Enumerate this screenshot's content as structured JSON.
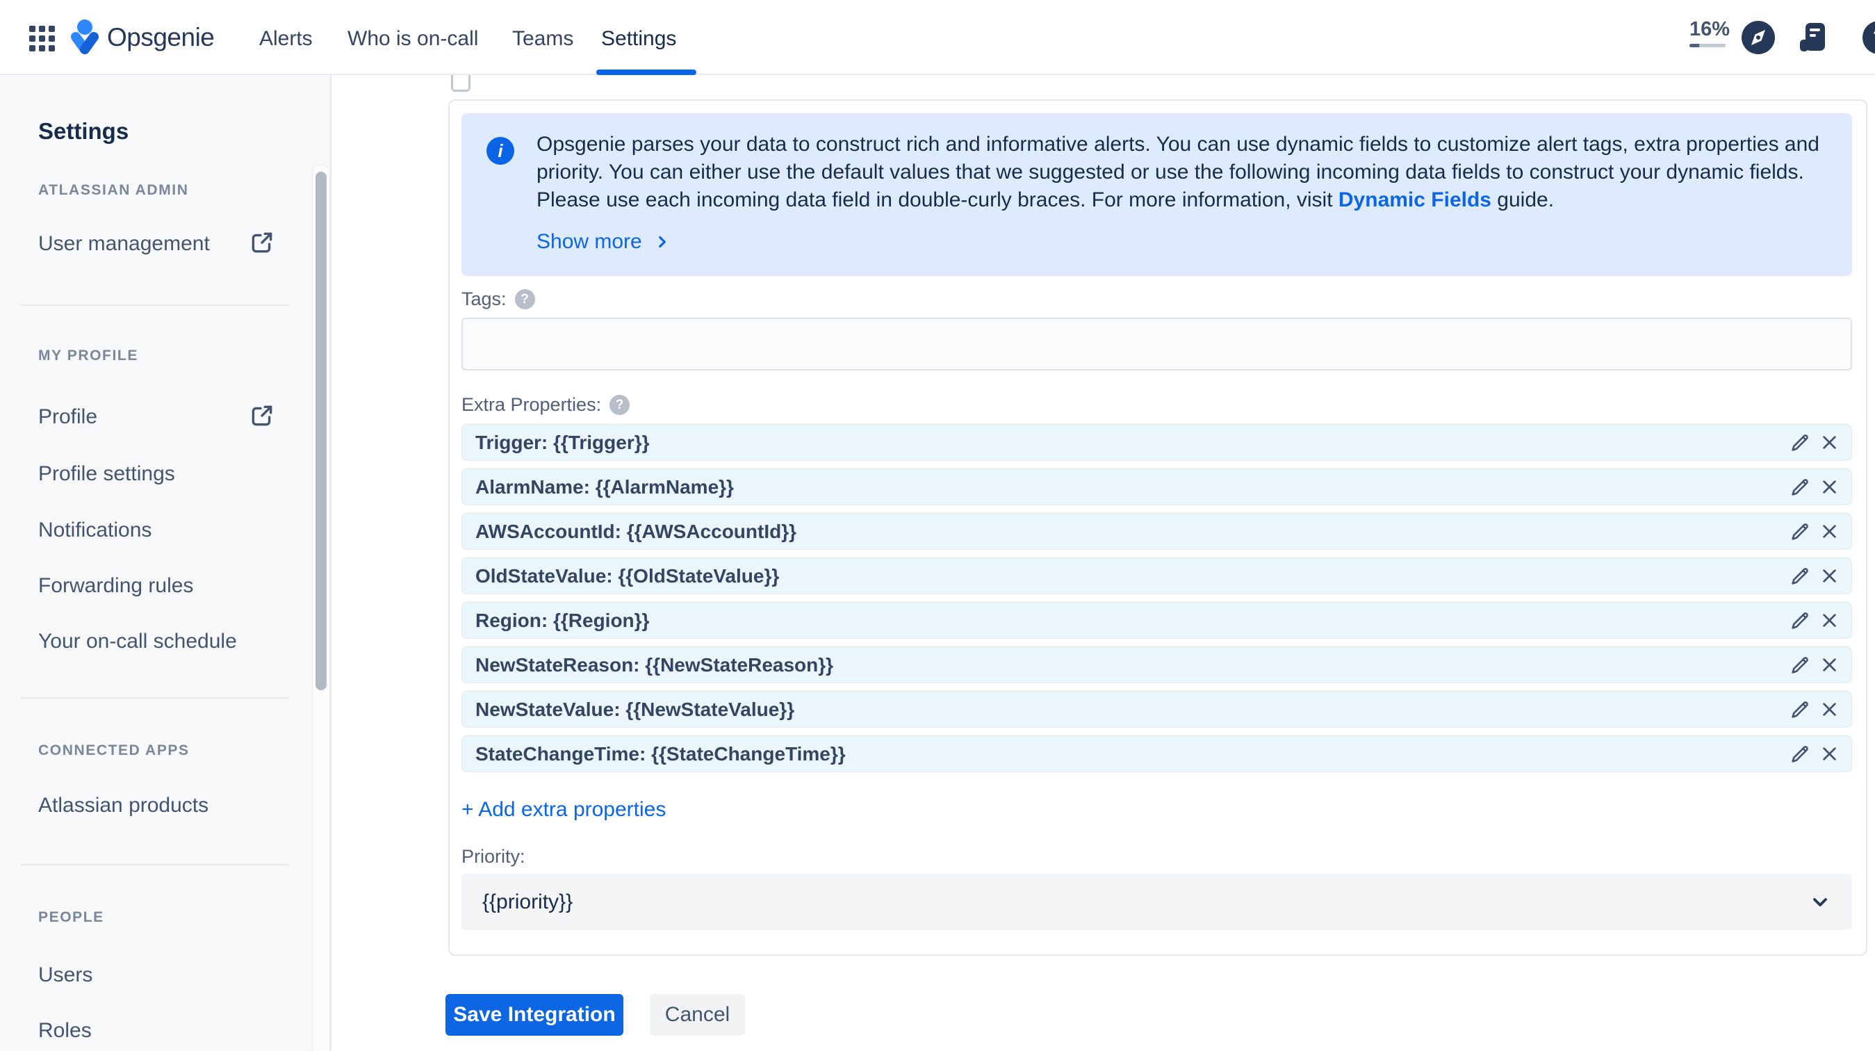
{
  "header": {
    "wordmark": "Opsgenie",
    "nav": {
      "alerts": "Alerts",
      "who_is_on_call": "Who is on-call",
      "teams": "Teams",
      "settings": "Settings",
      "active": "Settings"
    },
    "usage_percent": "16%",
    "icons": [
      "app-switcher",
      "compass",
      "release-notes",
      "help"
    ],
    "accent_color": "#0C66E4"
  },
  "sidebar": {
    "title": "Settings",
    "sections": [
      {
        "label": "ATLASSIAN ADMIN",
        "items": [
          {
            "label": "User management",
            "external": true
          }
        ]
      },
      {
        "label": "MY PROFILE",
        "items": [
          {
            "label": "Profile",
            "external": true
          },
          {
            "label": "Profile settings"
          },
          {
            "label": "Notifications"
          },
          {
            "label": "Forwarding rules"
          },
          {
            "label": "Your on-call schedule"
          }
        ]
      },
      {
        "label": "CONNECTED APPS",
        "items": [
          {
            "label": "Atlassian products"
          }
        ]
      },
      {
        "label": "PEOPLE",
        "items": [
          {
            "label": "Users"
          },
          {
            "label": "Roles"
          }
        ]
      }
    ]
  },
  "main": {
    "banner": {
      "background": "#DEEBFF",
      "line1": "Opsgenie parses your data to construct rich and informative alerts. You can use dynamic fields to customize alert tags, extra properties and",
      "line2": "priority. You can either use the default values that we suggested or use the following incoming data fields to construct your dynamic fields.",
      "line3_before": "Please use each incoming data field in double-curly braces. For more information, visit ",
      "link_label": "Dynamic Fields",
      "line3_after": " guide.",
      "show_more": "Show more"
    },
    "tags": {
      "label": "Tags:",
      "value": "",
      "placeholder": ""
    },
    "extra_properties": {
      "label": "Extra Properties:",
      "rows": [
        {
          "value": "Trigger: {{Trigger}}"
        },
        {
          "value": "AlarmName: {{AlarmName}}"
        },
        {
          "value": "AWSAccountId: {{AWSAccountId}}"
        },
        {
          "value": "OldStateValue: {{OldStateValue}}"
        },
        {
          "value": "Region: {{Region}}"
        },
        {
          "value": "NewStateReason: {{NewStateReason}}"
        },
        {
          "value": "NewStateValue: {{NewStateValue}}"
        },
        {
          "value": "StateChangeTime: {{StateChangeTime}}"
        }
      ],
      "add_label": "+ Add extra properties"
    },
    "priority": {
      "label": "Priority:",
      "value": "{{priority}}"
    },
    "buttons": {
      "save": "Save Integration",
      "cancel": "Cancel"
    }
  }
}
